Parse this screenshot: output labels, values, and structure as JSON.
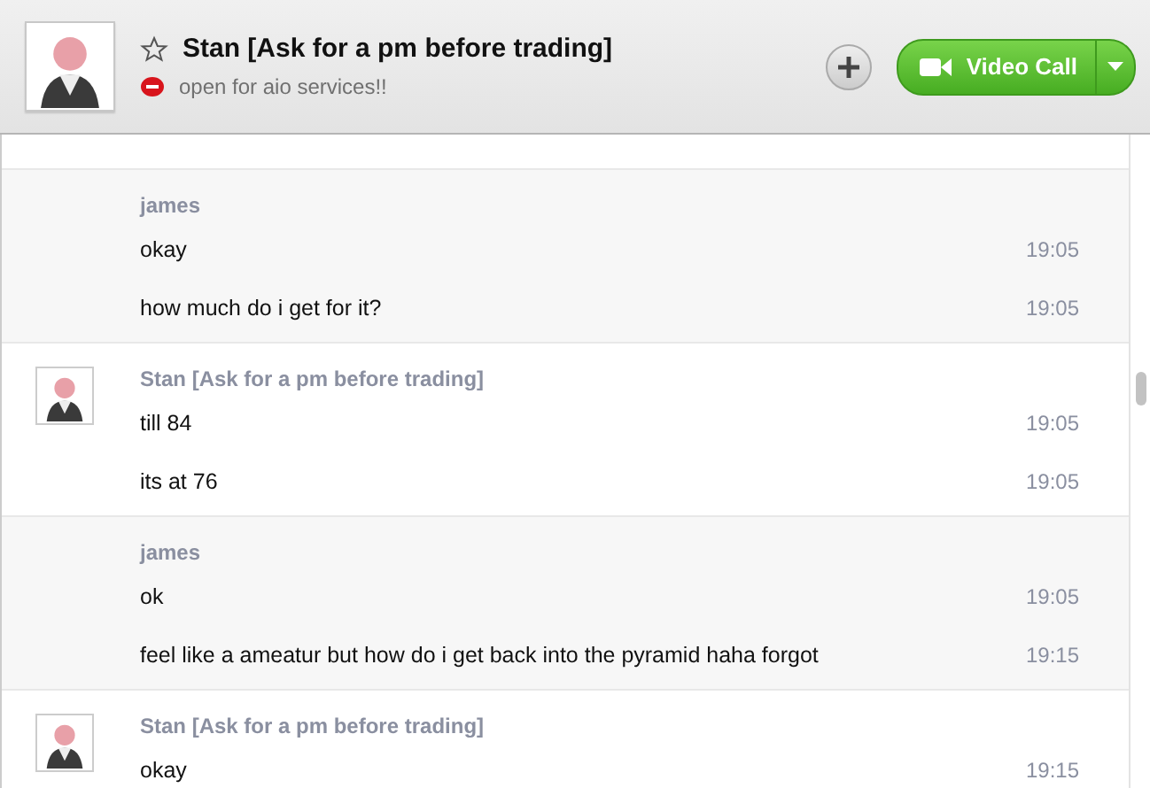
{
  "header": {
    "title": "Stan [Ask for a pm before trading]",
    "favorite": false,
    "status_message": "open for aio services!!",
    "video_call_label": "Video Call"
  },
  "groups": [
    {
      "kind": "self",
      "sender": "james",
      "messages": [
        {
          "text": "okay",
          "time": "19:05"
        },
        {
          "text": "how much do i get for it?",
          "time": "19:05"
        }
      ]
    },
    {
      "kind": "contact",
      "sender": "Stan [Ask for a pm before trading]",
      "messages": [
        {
          "text": "till 84",
          "time": "19:05"
        },
        {
          "text": "its at 76",
          "time": "19:05"
        }
      ]
    },
    {
      "kind": "self",
      "sender": "james",
      "messages": [
        {
          "text": "ok",
          "time": "19:05"
        },
        {
          "text": "feel like a ameatur but how do i get back into the pyramid haha forgot",
          "time": "19:15"
        }
      ]
    },
    {
      "kind": "contact",
      "sender": "Stan [Ask for a pm before trading]",
      "messages": [
        {
          "text": "okay",
          "time": "19:15"
        }
      ]
    }
  ]
}
